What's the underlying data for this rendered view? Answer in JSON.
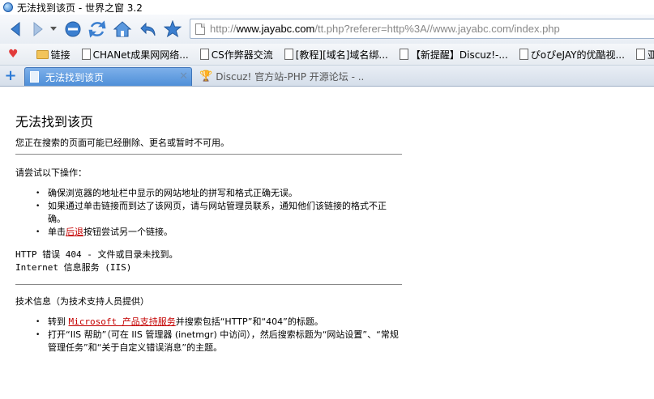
{
  "window": {
    "title": "无法找到该页 - 世界之窗 3.2"
  },
  "address_bar": {
    "url_prefix": "http://",
    "url_host": "www.jayabc.com",
    "url_rest": "/tt.php?referer=http%3A//www.jayabc.com/index.php"
  },
  "bookmarks": [
    {
      "label": "链接",
      "icon": "folder-icon"
    },
    {
      "label": "CHANet成果网网络...",
      "icon": "page-icon"
    },
    {
      "label": "CS作弊器交流",
      "icon": "page-icon"
    },
    {
      "label": "[教程][域名]域名绑...",
      "icon": "page-icon"
    },
    {
      "label": "【新提醒】Discuz!-...",
      "icon": "page-icon"
    },
    {
      "label": "ぴoぴeJAY的优酷视...",
      "icon": "page-icon"
    },
    {
      "label": "亚",
      "icon": "page-icon"
    }
  ],
  "tabs": [
    {
      "label": "无法找到该页",
      "active": true
    },
    {
      "label": "Discuz! 官方站-PHP 开源论坛 - ...",
      "active": false
    }
  ],
  "page": {
    "title": "无法找到该页",
    "subtitle": "您正在搜索的页面可能已经删除、更名或暂时不可用。",
    "try_heading": "请尝试以下操作：",
    "try_items": {
      "item1": "确保浏览器的地址栏中显示的网站地址的拼写和格式正确无误。",
      "item2": "如果通过单击链接而到达了该网页，请与网站管理员联系，通知他们该链接的格式不正确。",
      "item3_before": "单击",
      "item3_link": "后退",
      "item3_after": "按钮尝试另一个链接。"
    },
    "error_line1": "HTTP 错误 404 - 文件或目录未找到。",
    "error_line2": "Internet 信息服务 (IIS)",
    "tech_heading": "技术信息（为技术支持人员提供）",
    "tech_items": {
      "item1_before": "转到 ",
      "item1_link": "Microsoft 产品支持服务",
      "item1_after": "并搜索包括“HTTP”和“404”的标题。",
      "item2": "打开“IIS 帮助”（可在 IIS 管理器 (inetmgr) 中访问），然后搜索标题为“网站设置”、“常规管理任务”和“关于自定义错误消息”的主题。"
    }
  },
  "colors": {
    "link": "#c40000",
    "active_tab": "#4f8fd8",
    "nav_icon": "#3b7fd0"
  }
}
